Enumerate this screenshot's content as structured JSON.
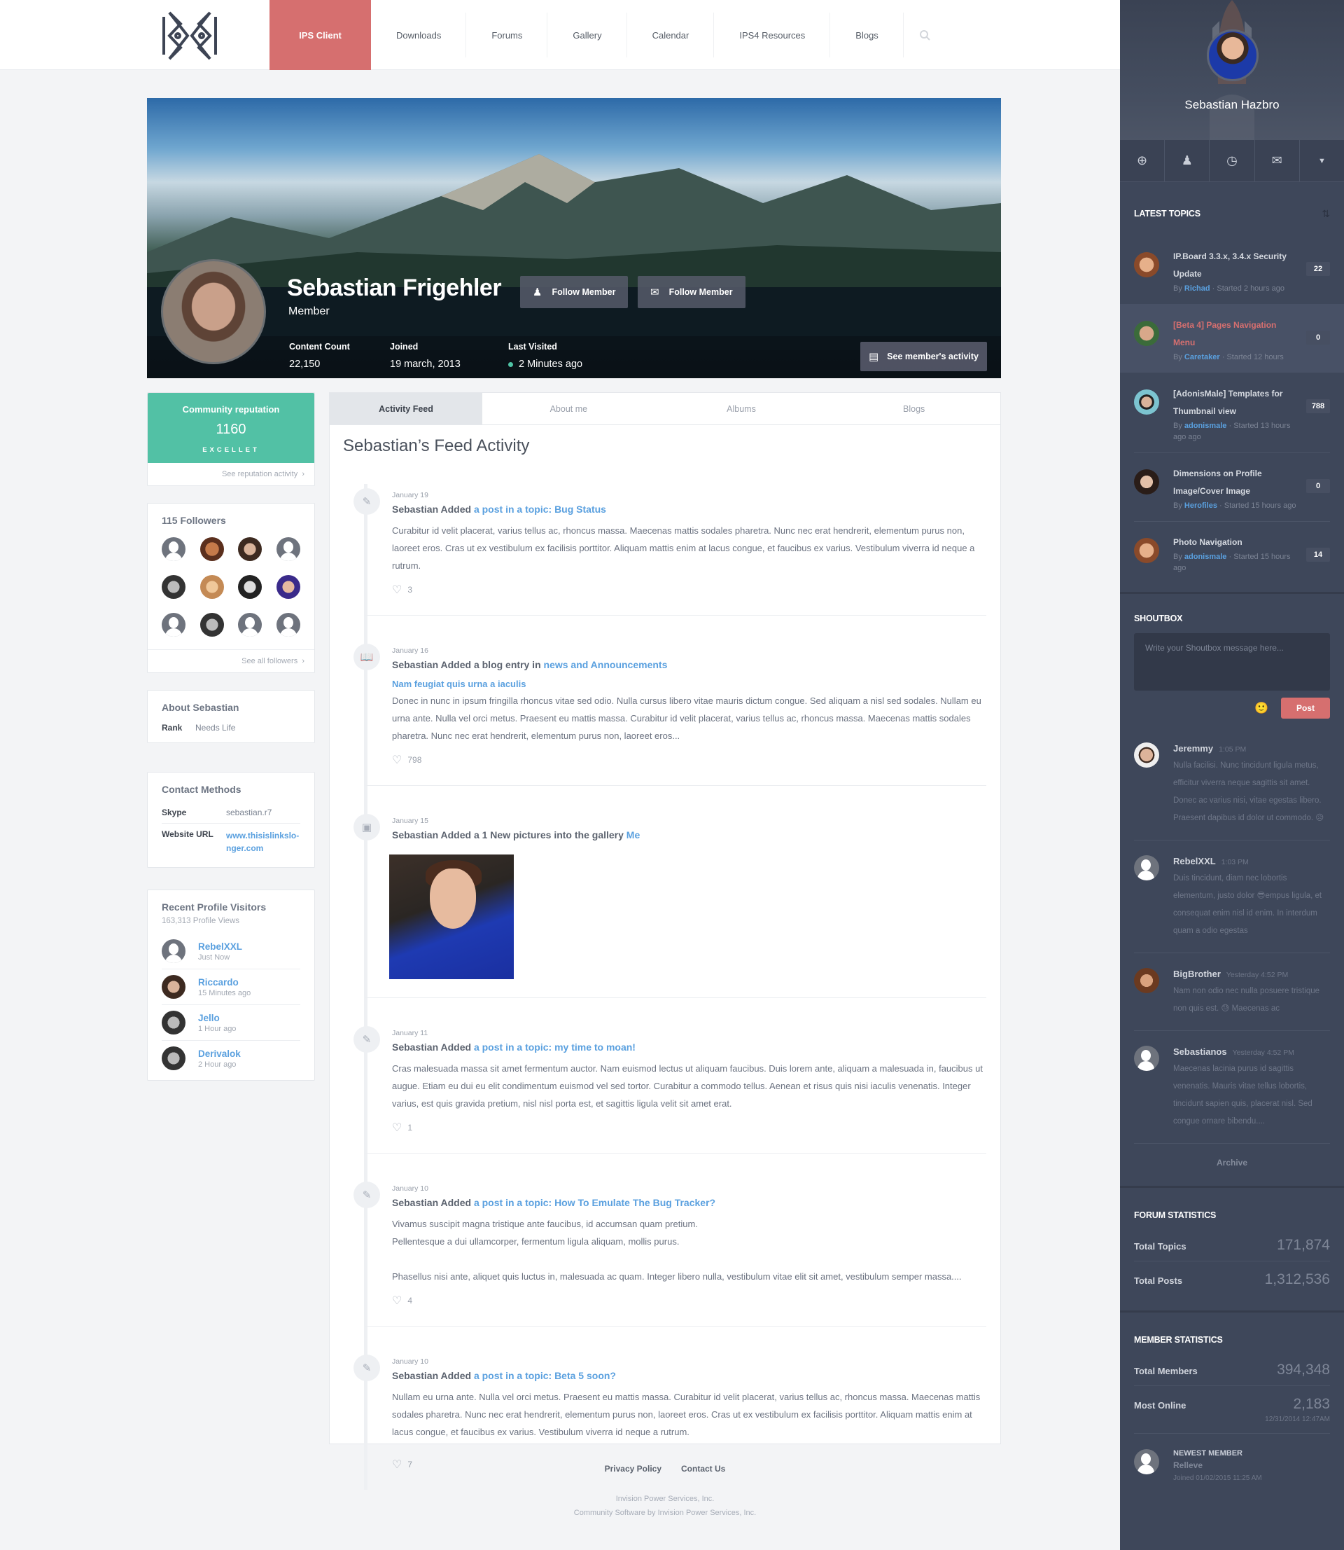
{
  "nav": {
    "items": [
      {
        "label": "IPS Client",
        "active": true
      },
      {
        "label": "Downloads"
      },
      {
        "label": "Forums"
      },
      {
        "label": "Gallery"
      },
      {
        "label": "Calendar"
      },
      {
        "label": "IPS4 Resources"
      },
      {
        "label": "Blogs"
      }
    ],
    "search_icon": "search-icon"
  },
  "profile": {
    "name": "Sebastian Frigehler",
    "role": "Member",
    "follow_button": "Follow Member",
    "message_button": "Follow Member",
    "stats": [
      {
        "label": "Content Count",
        "value": "22,150"
      },
      {
        "label": "Joined",
        "value": "19 march, 2013"
      },
      {
        "label": "Last Visited",
        "value": "2 Minutes ago"
      }
    ],
    "activity_button": "See member's activity"
  },
  "reputation": {
    "title": "Community reputation",
    "value": "1160",
    "level": "EXCELLET",
    "link": "See reputation activity"
  },
  "followers": {
    "title": "115 Followers",
    "link": "See all followers"
  },
  "about": {
    "title": "About Sebastian",
    "rank_label": "Rank",
    "rank_value": "Needs Life"
  },
  "contact": {
    "title": "Contact Methods",
    "skype_label": "Skype",
    "skype_value": "sebastian.r7",
    "url_label": "Website URL",
    "url_value": "www.thisislinkslo-nger.com"
  },
  "visitors": {
    "title": "Recent Profile Visitors",
    "views": "163,313 Profile Views",
    "items": [
      {
        "name": "RebelXXL",
        "time": "Just Now"
      },
      {
        "name": "Riccardo",
        "time": "15 Minutes ago"
      },
      {
        "name": "Jello",
        "time": "1 Hour ago"
      },
      {
        "name": "Derivalok",
        "time": "2 Hour ago"
      }
    ]
  },
  "tabs": [
    "Activity Feed",
    "About me",
    "Albums",
    "Blogs"
  ],
  "feed": {
    "title": "Sebastian’s Feed Activity",
    "entries": [
      {
        "date": "January 19",
        "prefix": "Sebastian Added",
        "link": "a post in a topic: Bug Status",
        "text": "Curabitur id velit placerat, varius tellus ac, rhoncus massa. Maecenas mattis sodales pharetra. Nunc nec erat hendrerit, elementum purus non, laoreet eros. Cras ut ex vestibulum ex facilisis porttitor. Aliquam mattis enim at lacus congue, et faucibus ex varius. Vestibulum viverra id neque a rutrum.",
        "likes": "3"
      },
      {
        "date": "January 16",
        "prefix": "Sebastian Added a blog entry in",
        "link": "news and Announcements",
        "subtitle": "Nam feugiat quis urna a iaculis",
        "text": "Donec in nunc in ipsum fringilla rhoncus vitae sed odio. Nulla cursus libero vitae mauris dictum congue. Sed aliquam a nisl sed sodales. Nullam eu urna ante. Nulla vel orci metus. Praesent eu mattis massa. Curabitur id velit placerat, varius tellus ac, rhoncus massa. Maecenas mattis sodales pharetra. Nunc nec erat hendrerit, elementum purus non, laoreet eros...",
        "likes": "798"
      },
      {
        "date": "January 15",
        "prefix": "Sebastian Added a 1 New pictures into the gallery",
        "link": "Me"
      },
      {
        "date": "January 11",
        "prefix": "Sebastian Added",
        "link": "a post in a topic: my time to moan!",
        "text": "Cras malesuada massa sit amet fermentum auctor. Nam euismod lectus ut aliquam faucibus. Duis lorem ante, aliquam a malesuada in, faucibus ut augue. Etiam eu dui eu elit condimentum euismod vel sed tortor. Curabitur a commodo tellus. Aenean et risus quis nisi iaculis venenatis. Integer varius, est quis gravida pretium, nisl nisl porta est, et sagittis ligula velit sit amet erat.",
        "likes": "1"
      },
      {
        "date": "January 10",
        "prefix": "Sebastian Added",
        "link": "a post in a topic: How To Emulate The Bug Tracker?",
        "text1": "Vivamus suscipit magna tristique ante faucibus, id accumsan quam pretium.",
        "text2": "Pellentesque a dui ullamcorper, fermentum ligula aliquam, mollis purus.",
        "text3": "Phasellus nisi ante, aliquet quis luctus in, malesuada ac quam. Integer libero nulla, vestibulum vitae elit sit amet, vestibulum semper massa....",
        "likes": "4"
      },
      {
        "date": "January 10",
        "prefix": "Sebastian Added",
        "link": "a post in a topic: Beta 5 soon?",
        "text": "Nullam eu urna ante. Nulla vel orci metus. Praesent eu mattis massa. Curabitur id velit placerat, varius tellus ac, rhoncus massa. Maecenas mattis sodales pharetra. Nunc nec erat hendrerit, elementum purus non, laoreet eros. Cras ut ex vestibulum ex facilisis porttitor. Aliquam mattis enim at lacus congue, et faucibus ex varius. Vestibulum viverra id neque a rutrum.",
        "likes": "7"
      }
    ]
  },
  "footer": {
    "links": [
      "Privacy Policy",
      "Contact Us"
    ],
    "line1": "Invision Power Services, Inc.",
    "line2": "Community Software by Invision Power Services, Inc."
  },
  "sidebar": {
    "user_name": "Sebastian Hazbro",
    "icons": [
      "add-icon",
      "user-icon",
      "clock-icon",
      "mail-icon",
      "dropdown-icon"
    ],
    "latest_topics": {
      "title": "LATEST TOPICS",
      "items": [
        {
          "title": "IP.Board 3.3.x, 3.4.x Security Update",
          "by": "By",
          "author": "Richad",
          "started": " · Started 2 hours ago",
          "count": "22"
        },
        {
          "title": "[Beta 4] Pages Navigation Menu",
          "by": "By",
          "author": "Caretaker",
          "started": " · Started 12 hours",
          "count": "0",
          "highlighted": true
        },
        {
          "title": "[AdonisMale] Templates for Thumbnail view",
          "by": "By",
          "author": "adonismale",
          "started": " · Started 13 hours ago ago",
          "count": "788"
        },
        {
          "title": "Dimensions on Profile Image/Cover Image",
          "by": "By",
          "author": "Herofiles",
          "started": " · Started 15 hours ago",
          "count": "0"
        },
        {
          "title": "Photo Navigation",
          "by": "By",
          "author": "adonismale",
          "started": " · Started 15 hours ago",
          "count": "14"
        }
      ]
    },
    "shoutbox": {
      "title": "SHOUTBOX",
      "placeholder": "Write your Shoutbox message here...",
      "post_label": "Post",
      "messages": [
        {
          "name": "Jeremmy",
          "time": "1:05 PM",
          "text": "Nulla facilisi. Nunc tincidunt ligula metus, efficitur viverra neque sagittis sit amet. Donec ac varius nisi, vitae egestas libero. Praesent dapibus id dolor ut commodo. 😥"
        },
        {
          "name": "RebelXXL",
          "time": "1:03 PM",
          "text": "Duis tincidunt, diam nec lobortis elementum, justo dolor 😎empus ligula, et consequat enim nisl id enim. In interdum quam a odio egestas"
        },
        {
          "name": "BigBrother",
          "time": "Yesterday 4:52 PM",
          "text": "Nam non odio nec nulla posuere tristique non quis est. 😓 Maecenas ac"
        },
        {
          "name": "Sebastianos",
          "time": "Yesterday 4:52 PM",
          "text": "Maecenas lacinia purus id sagittis venenatis. Mauris vitae tellus lobortis, tincidunt sapien quis, placerat nisl. Sed congue ornare bibendu...."
        }
      ],
      "archive": "Archive"
    },
    "forum_stats": {
      "title": "FORUM STATISTICS",
      "rows": [
        {
          "label": "Total Topics",
          "value": "171,874"
        },
        {
          "label": "Total Posts",
          "value": "1,312,536"
        }
      ]
    },
    "member_stats": {
      "title": "MEMBER STATISTICS",
      "total_label": "Total Members",
      "total_value": "394,348",
      "online_label": "Most Online",
      "online_value": "2,183",
      "online_date": "12/31/2014  12:47AM",
      "newest_label": "NEWEST MEMBER",
      "newest_name": "Relleve",
      "newest_joined": "Joined 01/02/2015  11:25 AM"
    }
  },
  "colors": {
    "accent": "#d66f6f",
    "reputation": "#52c1a5",
    "link": "#5aa0df",
    "sidebar": "#3e475a"
  }
}
